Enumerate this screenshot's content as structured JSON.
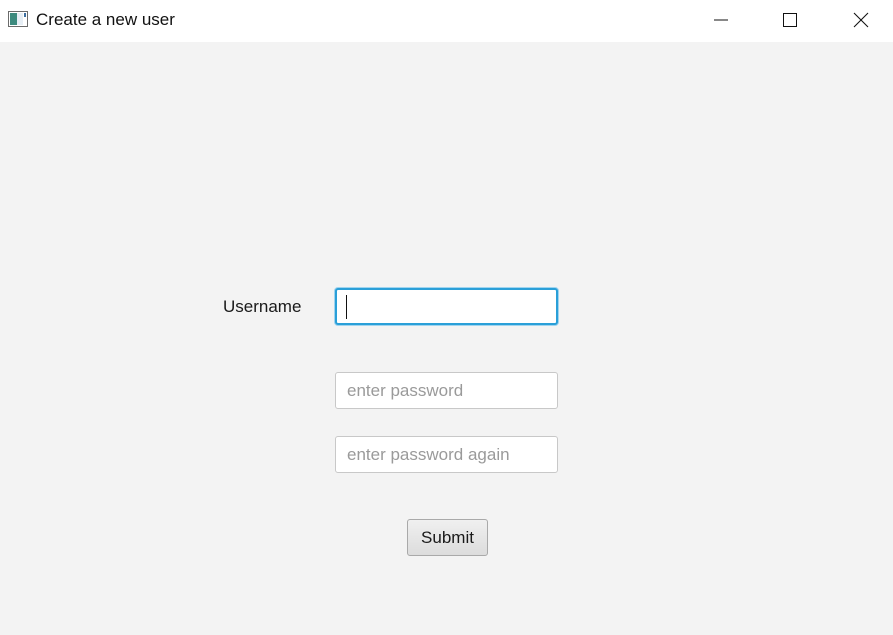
{
  "window": {
    "title": "Create a new user",
    "icon": "java-app-icon",
    "controls": {
      "minimize_icon": "minimize-icon",
      "maximize_icon": "maximize-icon",
      "close_icon": "close-icon"
    }
  },
  "form": {
    "username_label": "Username",
    "username_value": "",
    "password_placeholder": "enter password",
    "password_confirm_placeholder": "enter password again",
    "submit_label": "Submit"
  },
  "colors": {
    "background": "#f3f3f3",
    "titlebar": "#ffffff",
    "focus_accent": "#2a9fd8"
  }
}
